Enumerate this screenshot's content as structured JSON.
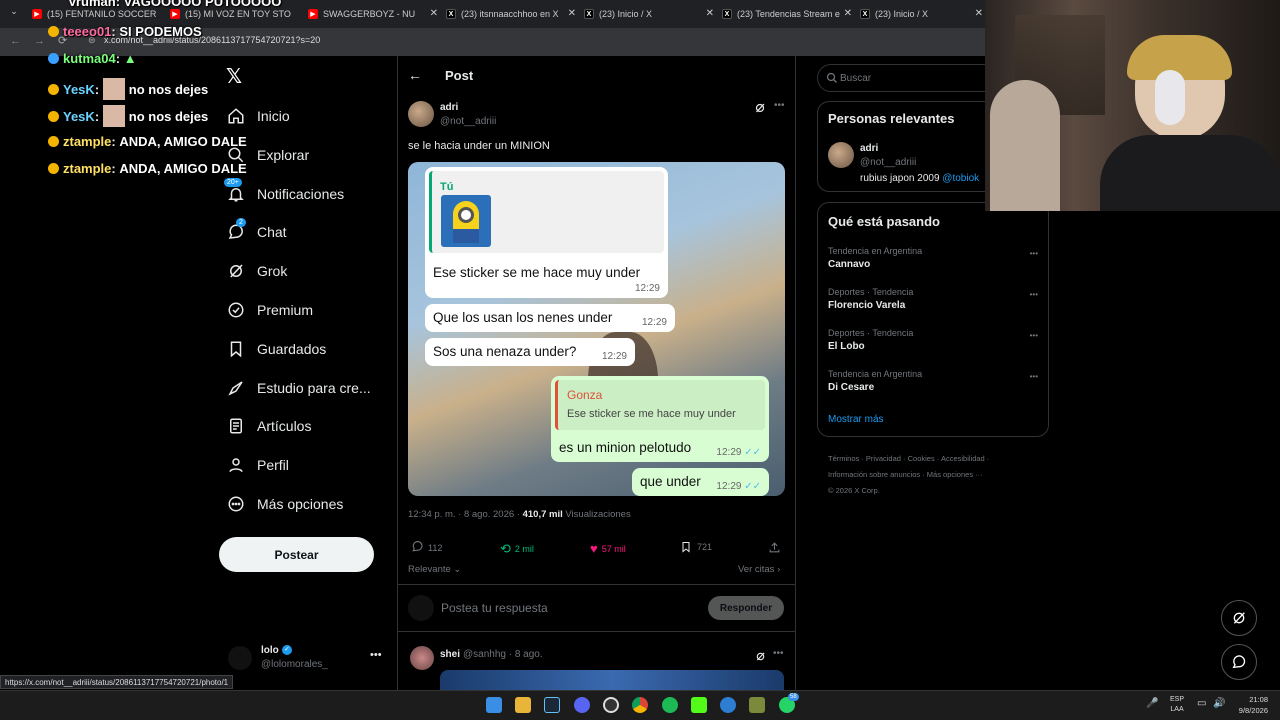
{
  "browser": {
    "tabs": [
      {
        "label": "(15) FENTANILO SOCCER",
        "color": "#ff0000"
      },
      {
        "label": "(15) MI VOZ EN TOY STO",
        "color": "#ff0000"
      },
      {
        "label": "SWAGGERBOYZ - NU",
        "color": "#ff0000"
      },
      {
        "label": "(23) itsnnaacchhoo en X",
        "color": "#000000"
      },
      {
        "label": "(23) Inicio / X",
        "color": "#000000"
      },
      {
        "label": "(23) Tendencias Stream e",
        "color": "#000000"
      },
      {
        "label": "(23) Inicio / X",
        "color": "#000000"
      }
    ],
    "url": "x.com/not__adriii/status/2086113717754720721?s=20",
    "status_url": "https://x.com/not__adriii/status/2086113717754720721/photo/1"
  },
  "overlay_chat": [
    {
      "user": "Vruman",
      "msg": "VAGOOOOO PUTOOOOO",
      "color": "#ffffff"
    },
    {
      "user": "teeeo01",
      "msg": "SI PODEMOS",
      "color": "#ff6b9e"
    },
    {
      "user": "kutma04",
      "msg": "",
      "color": "#7cff7c"
    },
    {
      "user": "YesK",
      "msg": "no nos dejes",
      "color": "#6bd3ff"
    },
    {
      "user": "YesK",
      "msg": "no nos dejes",
      "color": "#6bd3ff"
    },
    {
      "user": "ztample",
      "msg": "ANDA, AMIGO DALE",
      "color": "#ffe066"
    },
    {
      "user": "ztample",
      "msg": "ANDA, AMIGO DALE",
      "color": "#ffe066"
    }
  ],
  "nav": {
    "items": [
      {
        "label": "Inicio",
        "icon": "home-icon"
      },
      {
        "label": "Explorar",
        "icon": "search-icon"
      },
      {
        "label": "Notificaciones",
        "icon": "bell-icon",
        "badge": "20+"
      },
      {
        "label": "Chat",
        "icon": "chat-icon",
        "badge": "2"
      },
      {
        "label": "Grok",
        "icon": "grok-icon"
      },
      {
        "label": "Premium",
        "icon": "premium-icon"
      },
      {
        "label": "Guardados",
        "icon": "bookmark-icon"
      },
      {
        "label": "Estudio para cre...",
        "icon": "rocket-icon"
      },
      {
        "label": "Artículos",
        "icon": "article-icon"
      },
      {
        "label": "Perfil",
        "icon": "person-icon"
      },
      {
        "label": "Más opciones",
        "icon": "more-icon"
      }
    ],
    "post_button": "Postear",
    "account": {
      "name": "lolo",
      "handle": "@lolomorales_"
    }
  },
  "post": {
    "header": "Post",
    "author": "adri",
    "handle": "@not__adriii",
    "text": "se le hacia under un MINION",
    "time": "12:34 p. m. · 8 ago. 2026 ·",
    "views_count": "410,7 mil",
    "views_label": "Visualizaciones",
    "replies": "112",
    "reposts": "2 mil",
    "likes": "57 mil",
    "bookmarks": "721",
    "sort_label": "Relevante",
    "quotes_label": "Ver citas",
    "reply_placeholder": "Postea tu respuesta",
    "reply_button": "Responder"
  },
  "chat_image": {
    "quoted_name": "Tú",
    "msg1": "Ese sticker se me hace muy under",
    "msg1_time": "12:29",
    "msg2": "Que los usan los nenes under",
    "msg2_time": "12:29",
    "msg3": "Sos una nenaza under?",
    "msg3_time": "12:29",
    "reply_quote_name": "Gonza",
    "reply_quote_text": "Ese sticker se me hace muy under",
    "msg4": "es un minion pelotudo",
    "msg4_time": "12:29",
    "msg5": "que under",
    "msg5_time": "12:29"
  },
  "reply": {
    "author": "shei",
    "handle": "@sanhhg · 8 ago."
  },
  "sidebar": {
    "search_placeholder": "Buscar",
    "relevant_title": "Personas relevantes",
    "relevant_name": "adri",
    "relevant_handle": "@not__adriii",
    "relevant_bio": "rubius japon 2009",
    "relevant_bio_link": "@tobiok",
    "trends_title": "Qué está pasando",
    "trends": [
      {
        "sub": "Tendencia en Argentina",
        "title": "Cannavo"
      },
      {
        "sub": "Deportes · Tendencia",
        "title": "Florencio Varela"
      },
      {
        "sub": "Deportes · Tendencia",
        "title": "El Lobo"
      },
      {
        "sub": "Tendencia en Argentina",
        "title": "Di Cesare"
      }
    ],
    "show_more": "Mostrar más",
    "footer1": "Términos · Privacidad · Cookies · Accesibilidad ·",
    "footer2": "Información sobre anuncios · Más opciones ···",
    "footer3": "© 2026 X Corp."
  },
  "taskbar": {
    "lang1": "ESP",
    "lang2": "LAA",
    "time": "21:08",
    "date": "9/8/2026",
    "whatsapp_badge": "58"
  }
}
